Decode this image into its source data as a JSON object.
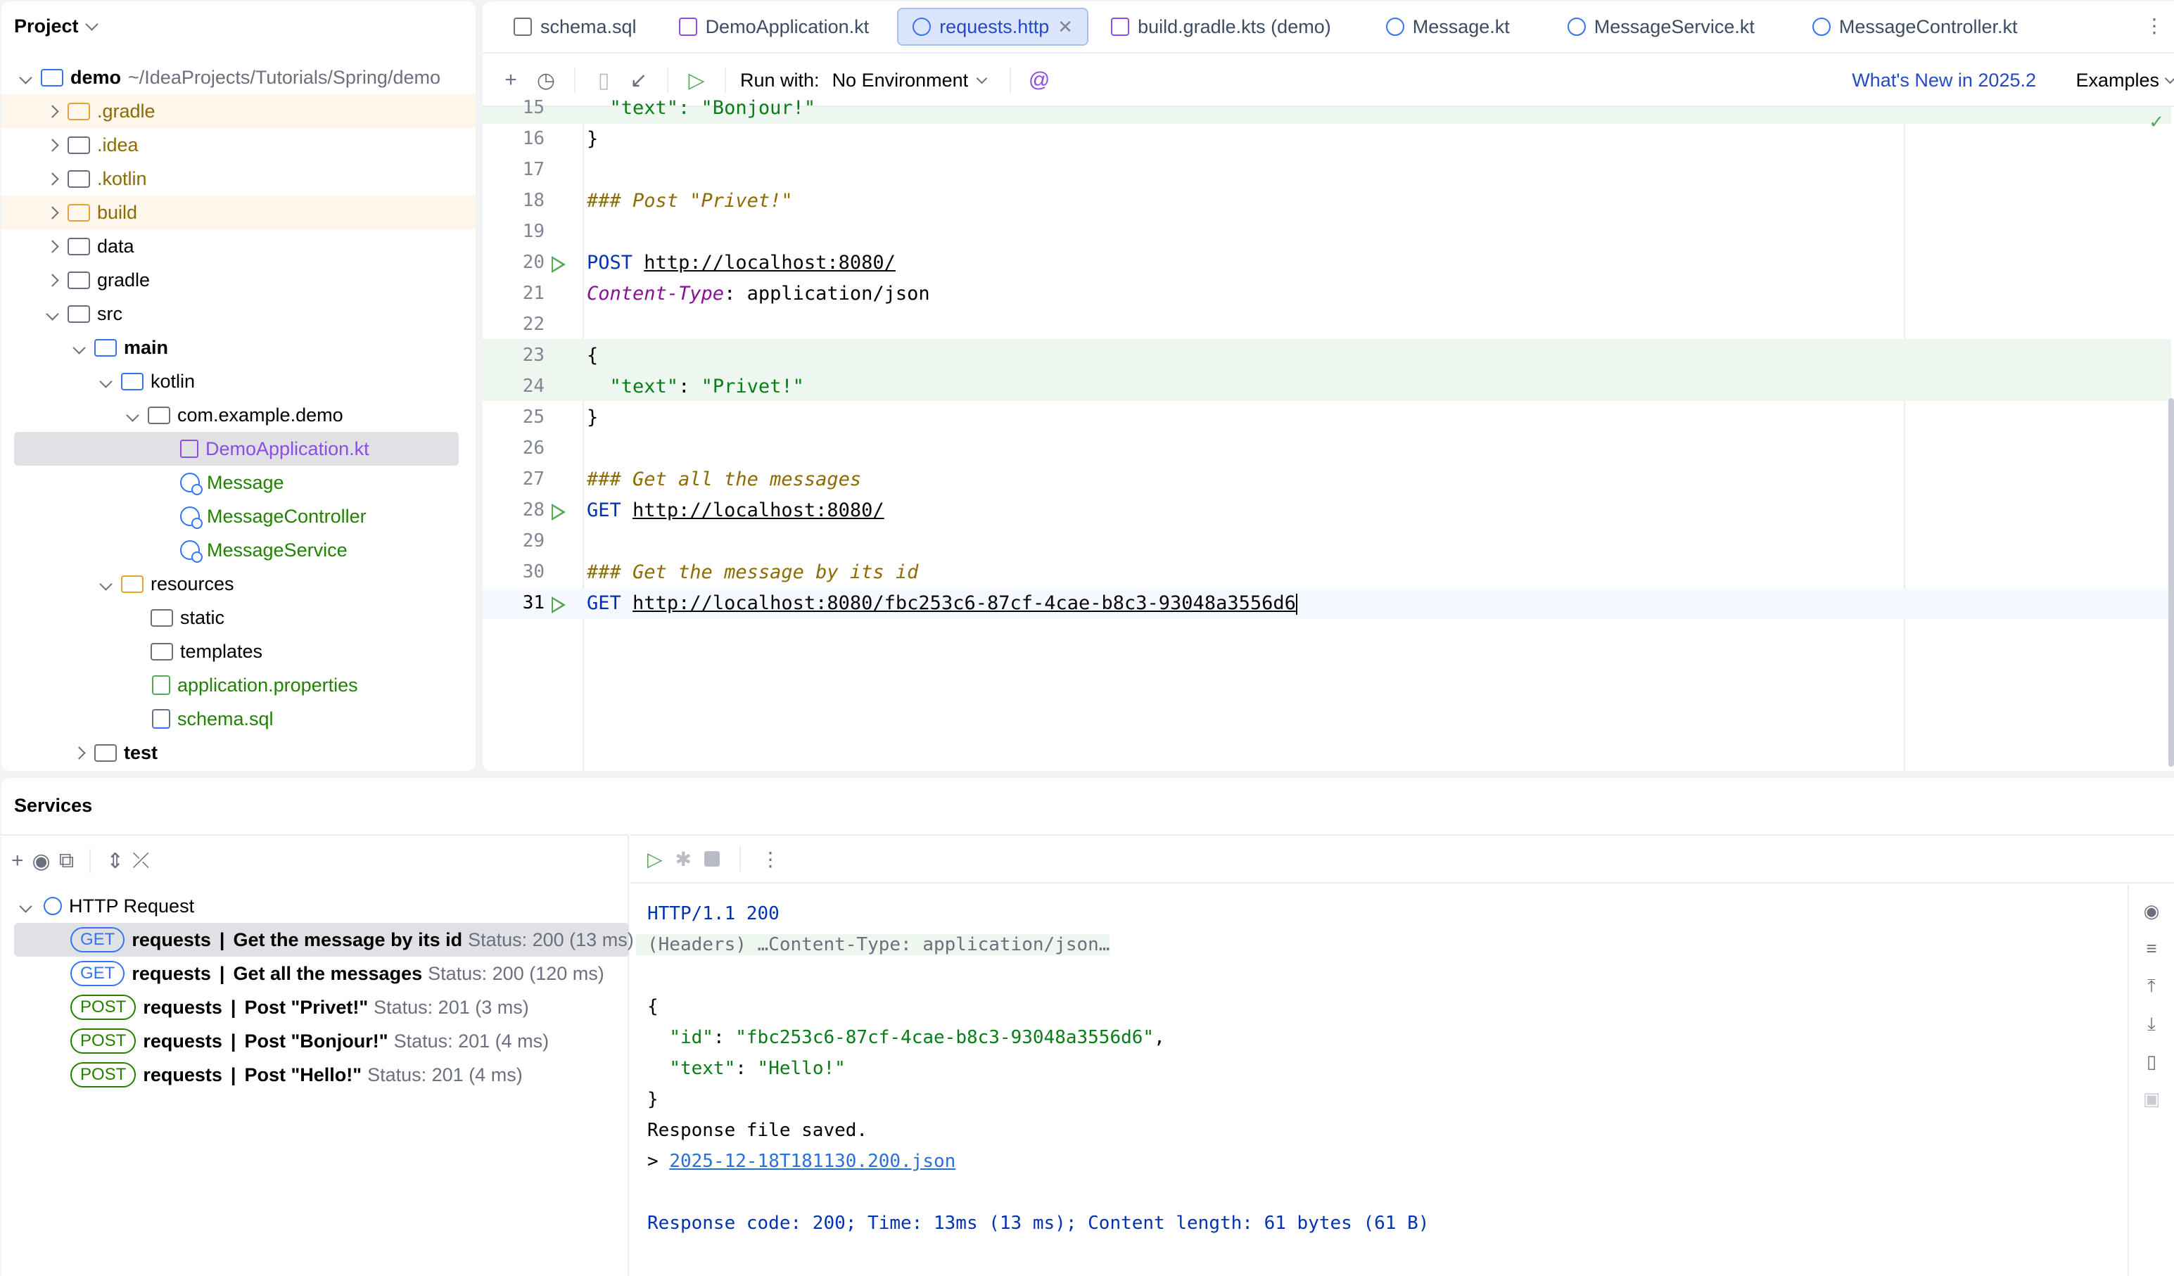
{
  "project": {
    "title": "Project",
    "root_name": "demo",
    "root_path": "~/IdeaProjects/Tutorials/Spring/demo",
    "items": [
      {
        "label": "demo",
        "path": "~/IdeaProjects/Tutorials/Spring/demo"
      },
      {
        "label": ".gradle"
      },
      {
        "label": ".idea"
      },
      {
        "label": ".kotlin"
      },
      {
        "label": "build"
      },
      {
        "label": "data"
      },
      {
        "label": "gradle"
      },
      {
        "label": "src"
      },
      {
        "label": "main"
      },
      {
        "label": "kotlin"
      },
      {
        "label": "com.example.demo"
      },
      {
        "label": "DemoApplication.kt"
      },
      {
        "label": "Message"
      },
      {
        "label": "MessageController"
      },
      {
        "label": "MessageService"
      },
      {
        "label": "resources"
      },
      {
        "label": "static"
      },
      {
        "label": "templates"
      },
      {
        "label": "application.properties"
      },
      {
        "label": "schema.sql"
      },
      {
        "label": "test"
      }
    ]
  },
  "tabs": [
    {
      "label": "schema.sql"
    },
    {
      "label": "DemoApplication.kt"
    },
    {
      "label": "requests.http"
    },
    {
      "label": "build.gradle.kts (demo)"
    },
    {
      "label": "Message.kt"
    },
    {
      "label": "MessageService.kt"
    },
    {
      "label": "MessageController.kt"
    }
  ],
  "toolbar": {
    "run_with_label": "Run with:",
    "environment": "No Environment",
    "whats_new": "What's New in 2025.2",
    "examples": "Examples"
  },
  "editor": {
    "lines": [
      {
        "n": "15",
        "text": "  \"text\": \"Bonjour!\""
      },
      {
        "n": "16",
        "text": "}"
      },
      {
        "n": "17",
        "text": ""
      },
      {
        "n": "18",
        "text": "### Post \"Privet!\""
      },
      {
        "n": "19",
        "text": ""
      },
      {
        "n": "20",
        "method": "POST",
        "url": "http://localhost:8080/"
      },
      {
        "n": "21",
        "header": "Content-Type",
        "value": ": application/json"
      },
      {
        "n": "22",
        "text": ""
      },
      {
        "n": "23",
        "text": "{"
      },
      {
        "n": "24",
        "key": "\"text\"",
        "colon": ": ",
        "val": "\"Privet!\""
      },
      {
        "n": "25",
        "text": "}"
      },
      {
        "n": "26",
        "text": ""
      },
      {
        "n": "27",
        "text": "### Get all the messages"
      },
      {
        "n": "28",
        "method": "GET",
        "url": "http://localhost:8080/"
      },
      {
        "n": "29",
        "text": ""
      },
      {
        "n": "30",
        "text": "### Get the message by its id"
      },
      {
        "n": "31",
        "method": "GET",
        "url": "http://localhost:8080/fbc253c6-87cf-4cae-b8c3-93048a3556d6"
      }
    ]
  },
  "services": {
    "title": "Services",
    "group": "HTTP Request",
    "requests": [
      {
        "method": "GET",
        "file": "requests",
        "name": "Get the message by its id",
        "status": "Status: 200 (13 ms)"
      },
      {
        "method": "GET",
        "file": "requests",
        "name": "Get all the messages",
        "status": "Status: 200 (120 ms)"
      },
      {
        "method": "POST",
        "file": "requests",
        "name": "Post \"Privet!\"",
        "status": "Status: 201 (3 ms)"
      },
      {
        "method": "POST",
        "file": "requests",
        "name": "Post \"Bonjour!\"",
        "status": "Status: 201 (4 ms)"
      },
      {
        "method": "POST",
        "file": "requests",
        "name": "Post \"Hello!\"",
        "status": "Status: 201 (4 ms)"
      }
    ],
    "response": {
      "status_line": "HTTP/1.1 200",
      "headers": "(Headers) …Content-Type: application/json…",
      "body_open": "{",
      "id_key": "\"id\"",
      "id_val": "\"fbc253c6-87cf-4cae-b8c3-93048a3556d6\"",
      "text_key": "\"text\"",
      "text_val": "\"Hello!\"",
      "body_close": "}",
      "saved": "Response file saved.",
      "file_prefix": "> ",
      "file_link": "2025-12-18T181130.200.json",
      "summary": "Response code: 200; Time: 13ms (13 ms); Content length: 61 bytes (61 B)"
    }
  }
}
